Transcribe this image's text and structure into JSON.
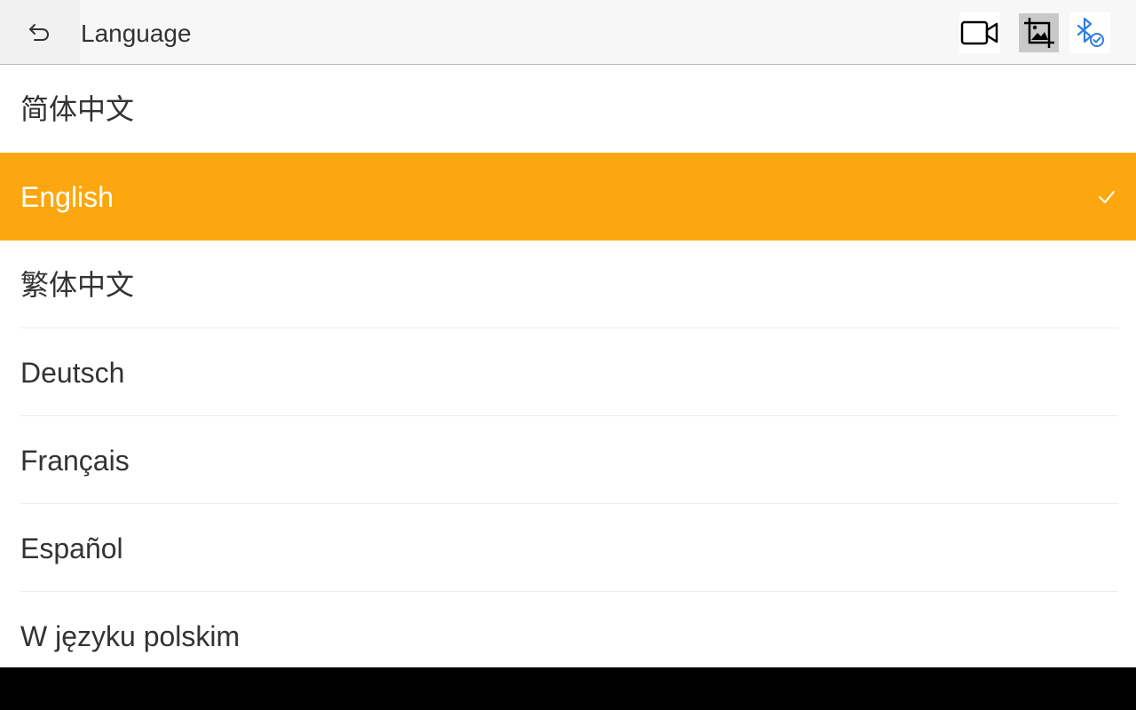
{
  "header": {
    "title": "Language",
    "back_icon": "back-arrow-icon",
    "tools": [
      {
        "name": "video-camera-icon"
      },
      {
        "name": "crop-image-icon",
        "active": true
      },
      {
        "name": "bluetooth-connected-icon",
        "color": "#2f7fdc"
      }
    ]
  },
  "languages": [
    {
      "label": "简体中文",
      "selected": false
    },
    {
      "label": "English",
      "selected": true
    },
    {
      "label": "繁体中文",
      "selected": false
    },
    {
      "label": "Deutsch",
      "selected": false
    },
    {
      "label": "Français",
      "selected": false
    },
    {
      "label": "Español",
      "selected": false
    },
    {
      "label": "W języku polskim",
      "selected": false
    }
  ],
  "colors": {
    "accent": "#fca710",
    "text": "#333333",
    "header_bg": "#f7f7f7"
  }
}
